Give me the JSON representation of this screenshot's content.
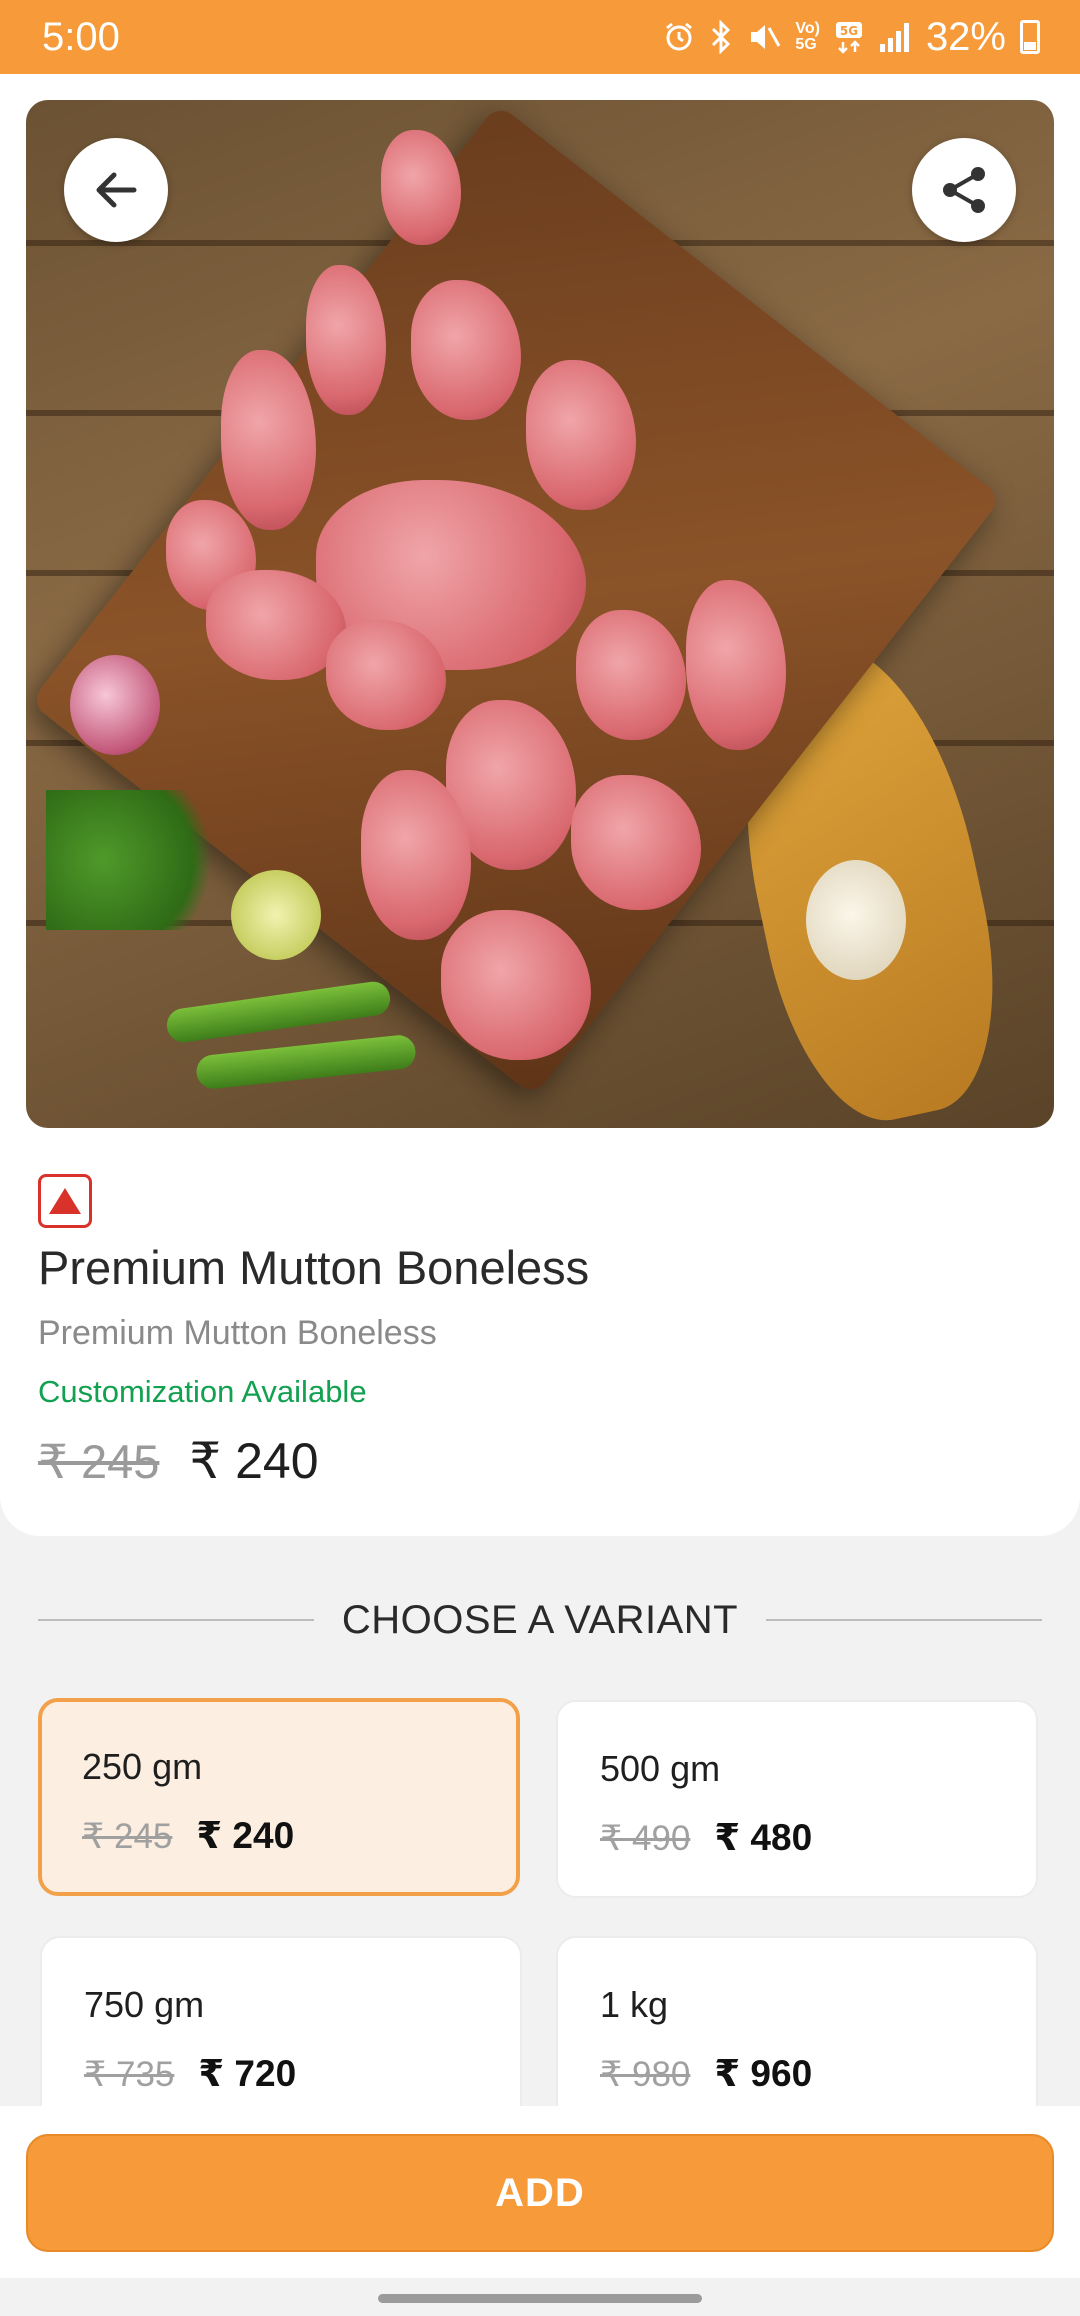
{
  "status_bar": {
    "time": "5:00",
    "battery": "32%",
    "icons": [
      "alarm-icon",
      "bluetooth-icon",
      "mute-icon",
      "volte-5g-icon",
      "5g-data-icon",
      "signal-icon",
      "battery-icon"
    ]
  },
  "product": {
    "title": "Premium Mutton Boneless",
    "subtitle": "Premium Mutton Boneless",
    "customization": "Customization Available",
    "price_old": "₹ 245",
    "price_new": "₹ 240",
    "diet_mark": "non-veg"
  },
  "variants": {
    "heading": "CHOOSE A VARIANT",
    "items": [
      {
        "name": "250 gm",
        "old": "₹ 245",
        "new": "₹ 240",
        "selected": true
      },
      {
        "name": "500 gm",
        "old": "₹ 490",
        "new": "₹ 480",
        "selected": false
      },
      {
        "name": "750 gm",
        "old": "₹ 735",
        "new": "₹ 720",
        "selected": false
      },
      {
        "name": "1 kg",
        "old": "₹ 980",
        "new": "₹ 960",
        "selected": false
      }
    ]
  },
  "actions": {
    "add_label": "ADD"
  },
  "colors": {
    "accent": "#f69a3a",
    "selected_bg": "#fcefe1",
    "customization": "#12a150",
    "nonveg": "#d8322a"
  }
}
